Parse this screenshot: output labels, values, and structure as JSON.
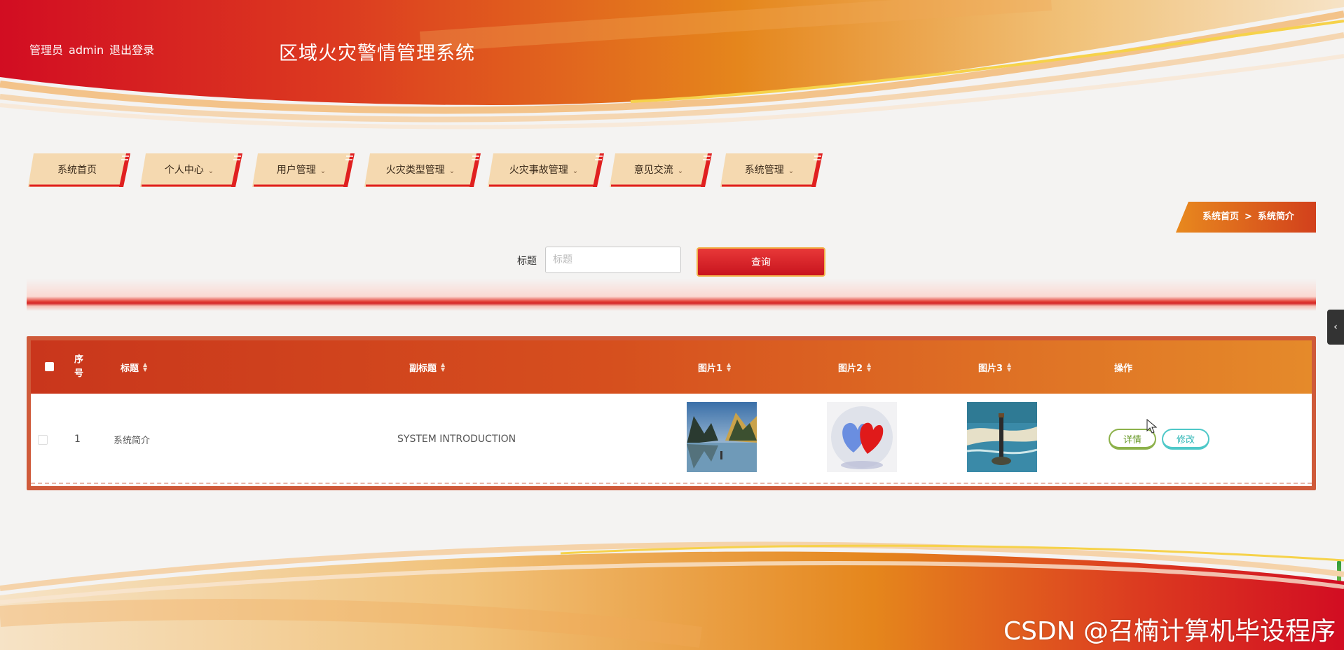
{
  "header": {
    "user_role": "管理员",
    "username": "admin",
    "logout_label": "退出登录",
    "system_title": "区域火灾警情管理系统"
  },
  "nav": {
    "items": [
      {
        "label": "系统首页",
        "has_dropdown": false
      },
      {
        "label": "个人中心",
        "has_dropdown": true
      },
      {
        "label": "用户管理",
        "has_dropdown": true
      },
      {
        "label": "火灾类型管理",
        "has_dropdown": true
      },
      {
        "label": "火灾事故管理",
        "has_dropdown": true
      },
      {
        "label": "意见交流",
        "has_dropdown": true
      },
      {
        "label": "系统管理",
        "has_dropdown": true
      }
    ],
    "caret_icon": "chevron-down-icon"
  },
  "breadcrumb": {
    "home": "系统首页",
    "separator": ">",
    "current": "系统简介"
  },
  "search": {
    "label": "标题",
    "placeholder": "标题",
    "value": "",
    "button_label": "查询"
  },
  "table": {
    "columns": {
      "seq": "序号",
      "title": "标题",
      "subtitle": "副标题",
      "image1": "图片1",
      "image2": "图片2",
      "image3": "图片3",
      "actions": "操作"
    },
    "rows": [
      {
        "seq": "1",
        "title": "系统简介",
        "subtitle": "SYSTEM INTRODUCTION",
        "detail_label": "详情",
        "edit_label": "修改"
      }
    ]
  },
  "colors": {
    "brand_red": "#d0101e",
    "brand_orange": "#e58a2a",
    "nav_tab": "#f5d9b0",
    "detail_green": "#8cb14a",
    "edit_teal": "#4ec8c8"
  },
  "watermark": "CSDN @召楠计算机毕设程序"
}
